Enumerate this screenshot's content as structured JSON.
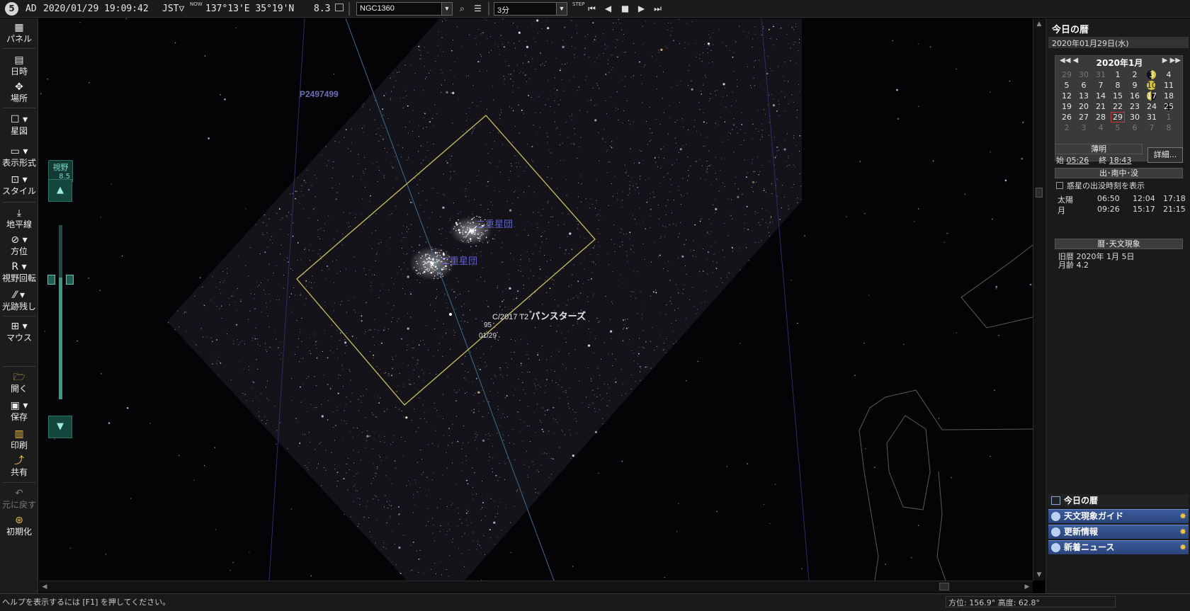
{
  "toolbar": {
    "logo": "5",
    "era": "AD",
    "datetime": "2020/01/29 19:09:42",
    "timezone": "JST▽",
    "now_icon": "NOW",
    "coords": "137°13'E 35°19'N",
    "fov": "8.3",
    "target": "NGC1360",
    "step": "3分",
    "step_icon": "STEP"
  },
  "sidebar": {
    "items": [
      {
        "label": "パネル",
        "icon": "panel-icon"
      },
      {
        "label": "日時",
        "icon": "calendar-icon"
      },
      {
        "label": "場所",
        "icon": "location-icon"
      },
      {
        "label": "星図",
        "icon": "starmap-icon"
      },
      {
        "label": "表示形式",
        "icon": "display-icon"
      },
      {
        "label": "スタイル",
        "icon": "style-icon"
      },
      {
        "label": "地平線",
        "icon": "horizon-icon"
      },
      {
        "label": "方位",
        "icon": "compass-icon"
      },
      {
        "label": "視野回転",
        "icon": "rotate-icon"
      },
      {
        "label": "光跡残し",
        "icon": "trail-icon"
      },
      {
        "label": "マウス",
        "icon": "mouse-icon"
      },
      {
        "label": "開く",
        "icon": "open-icon"
      },
      {
        "label": "保存",
        "icon": "save-icon"
      },
      {
        "label": "印刷",
        "icon": "print-icon"
      },
      {
        "label": "共有",
        "icon": "share-icon"
      },
      {
        "label": "元に戻す",
        "icon": "undo-icon"
      },
      {
        "label": "初期化",
        "icon": "reset-icon"
      }
    ],
    "fov_label": "視野",
    "fov_value": "8.5"
  },
  "sky": {
    "label_asteroid": "P2497499",
    "label_cluster1": "二重星団",
    "label_cluster2": "二重星団",
    "comet_prefix": "C/2017 T2",
    "comet_name": "パンスターズ",
    "comet_mag": "95",
    "comet_date": "01/29"
  },
  "panel": {
    "title": "今日の暦",
    "date": "2020年01月29日(水)",
    "calendar": {
      "month": "2020年1月",
      "nav_prev": "◀◀ ◀",
      "nav_next": "▶ ▶▶",
      "weeks": [
        [
          "29",
          "30",
          "31",
          "1",
          "2",
          "3",
          "4"
        ],
        [
          "5",
          "6",
          "7",
          "8",
          "9",
          "10",
          "11"
        ],
        [
          "12",
          "13",
          "14",
          "15",
          "16",
          "17",
          "18"
        ],
        [
          "19",
          "20",
          "21",
          "22",
          "23",
          "24",
          "25"
        ],
        [
          "26",
          "27",
          "28",
          "29",
          "30",
          "31",
          "1"
        ],
        [
          "2",
          "3",
          "4",
          "5",
          "6",
          "7",
          "8"
        ]
      ]
    },
    "twilight_title": "薄明",
    "twilight_start_label": "始",
    "twilight_start": "05:26",
    "twilight_end_label": "終",
    "twilight_end": "18:43",
    "detail_button": "詳細...",
    "rise_title": "出･南中･没",
    "planet_checkbox": "惑星の出没時刻を表示",
    "rise_rows": [
      {
        "name": "太陽",
        "rise": "06:50",
        "transit": "12:04",
        "set": "17:18"
      },
      {
        "name": "月",
        "rise": "09:26",
        "transit": "15:17",
        "set": "21:15"
      }
    ],
    "ephem_title": "暦･天文現象",
    "lunar_date": "旧暦 2020年 1月 5日",
    "moon_age": "月齢 4.2",
    "footer_title": "今日の暦",
    "footer_items": [
      "天文現象ガイド",
      "更新情報",
      "新着ニュース"
    ]
  },
  "status": {
    "help": "ヘルプを表示するには [F1] を押してください。",
    "coords": "方位: 156.9°  高度: 62.8°"
  },
  "colors": {
    "fov_rect": "#c9c35c",
    "meridian": "#4a6fa0",
    "accent_teal": "#3a9b86"
  }
}
